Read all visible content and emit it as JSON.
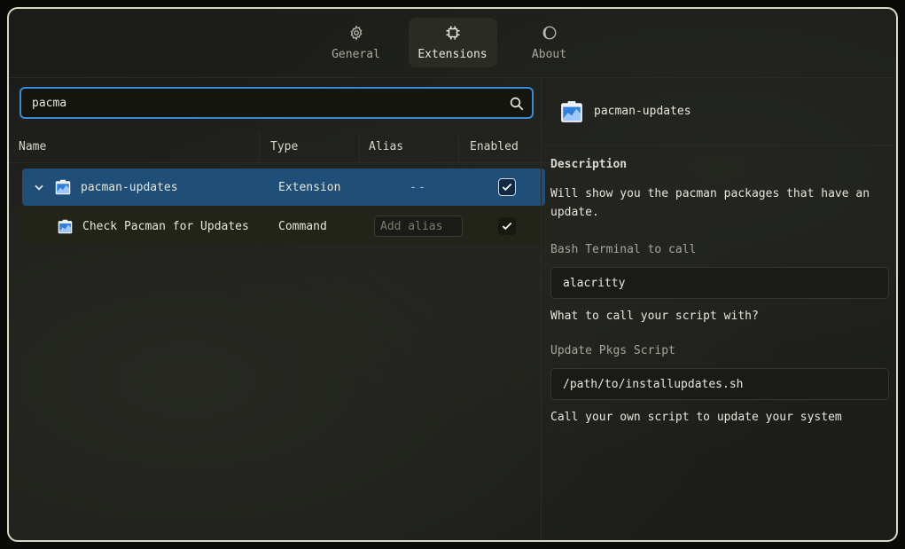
{
  "nav": {
    "tabs": [
      {
        "label": "General",
        "icon": "gear-icon",
        "active": false
      },
      {
        "label": "Extensions",
        "icon": "chip-icon",
        "active": true
      },
      {
        "label": "About",
        "icon": "moon-icon",
        "active": false
      }
    ]
  },
  "search": {
    "value": "pacma"
  },
  "table": {
    "headers": {
      "name": "Name",
      "type": "Type",
      "alias": "Alias",
      "enabled": "Enabled"
    },
    "rows": [
      {
        "name": "pacman-updates",
        "type": "Extension",
        "alias": "--",
        "enabled": true
      },
      {
        "name": "Check Pacman for Updates",
        "type": "Command",
        "alias_placeholder": "Add alias",
        "enabled": true
      }
    ]
  },
  "details": {
    "title": "pacman-updates",
    "description_title": "Description",
    "description": "Will show you the pacman packages that have an update.",
    "fields": [
      {
        "label": "Bash Terminal to call",
        "value": "alacritty",
        "help": "What to call your script with?"
      },
      {
        "label": "Update Pkgs Script",
        "value": "/path/to/installupdates.sh",
        "help": "Call your own script to update your system"
      }
    ]
  },
  "colors": {
    "accent": "#3a8ad6",
    "selected_row": "#1f4f78",
    "border": "#d9d8c0"
  }
}
